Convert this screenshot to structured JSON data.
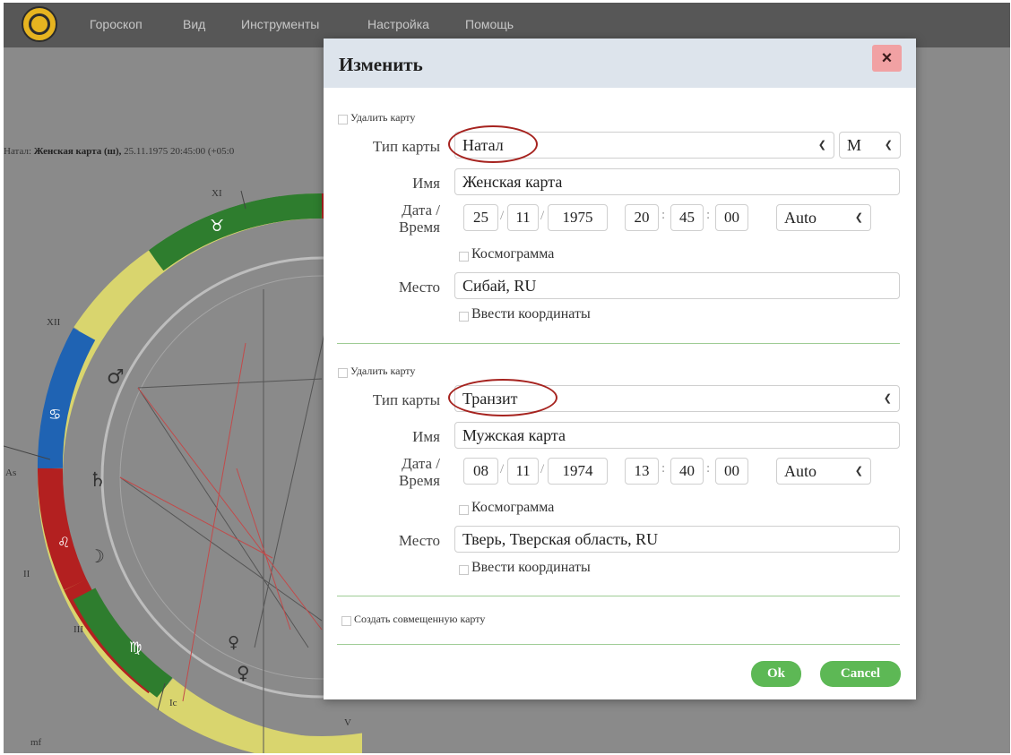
{
  "menubar": {
    "items": [
      "Гороскоп",
      "Вид",
      "Инструменты",
      "Настройка",
      "Помощь"
    ]
  },
  "background": {
    "chart_info_prefix": "Натал:",
    "chart_info_name": "Женская карта (ш),",
    "chart_info_rest": "25.11.1975 20:45:00 (+05:0",
    "house_labels": {
      "xi": "XI",
      "xii": "XII",
      "as": "As",
      "ii": "II",
      "iii": "III",
      "v": "V",
      "ic": "Ic"
    },
    "corner_text": "mf"
  },
  "dialog": {
    "title": "Изменить",
    "close_label": "×",
    "chart1": {
      "delete_label": "Удалить карту",
      "type_label": "Тип карты",
      "type_value": "Натал",
      "gender_value": "М",
      "name_label": "Имя",
      "name_value": "Женская карта",
      "datetime_label_1": "Дата /",
      "datetime_label_2": "Время",
      "day": "25",
      "month": "11",
      "year": "1975",
      "hour": "20",
      "minute": "45",
      "second": "00",
      "tz_value": "Auto",
      "cosmogram_label": "Космограмма",
      "place_label": "Место",
      "place_value": "Сибай, RU",
      "coords_label": "Ввести координаты"
    },
    "chart2": {
      "delete_label": "Удалить карту",
      "type_label": "Тип карты",
      "type_value": "Транзит",
      "name_label": "Имя",
      "name_value": "Мужская карта",
      "datetime_label_1": "Дата /",
      "datetime_label_2": "Время",
      "day": "08",
      "month": "11",
      "year": "1974",
      "hour": "13",
      "minute": "40",
      "second": "00",
      "tz_value": "Auto",
      "cosmogram_label": "Космограмма",
      "place_label": "Место",
      "place_value": "Тверь, Тверская область, RU",
      "coords_label": "Ввести координаты"
    },
    "combine_label": "Создать совмещенную карту",
    "ok_label": "Ok",
    "cancel_label": "Cancel"
  },
  "colors": {
    "accent_green": "#5db855",
    "annotation_red": "#a6231f"
  }
}
